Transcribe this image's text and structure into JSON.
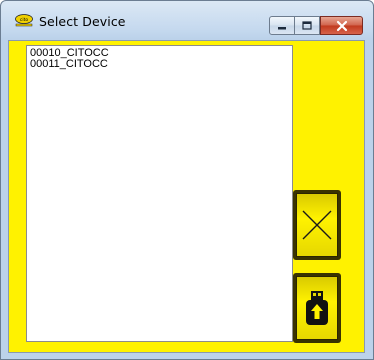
{
  "window": {
    "title": "Select Device",
    "controls": {
      "minimize": "minimize-icon",
      "maximize": "maximize-icon",
      "close": "close-icon"
    }
  },
  "device_list": {
    "items": [
      "00010_CITOCC",
      "00011_CITOCC"
    ]
  },
  "actions": {
    "cancel_icon": "x-cross-icon",
    "upload_icon": "usb-upload-icon"
  },
  "colors": {
    "client_background": "#fff200",
    "close_button": "#c1391d"
  }
}
